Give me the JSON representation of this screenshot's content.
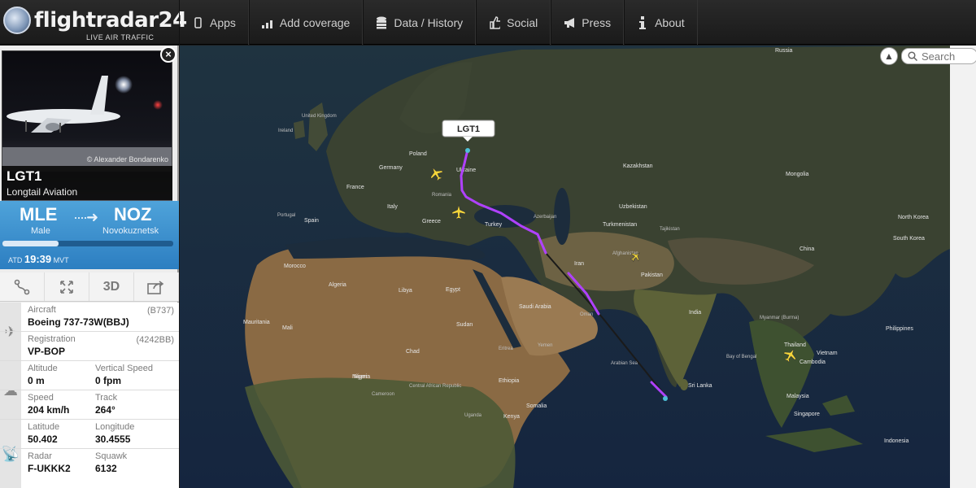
{
  "brand": {
    "name": "flightradar24",
    "tagline": "LIVE AIR TRAFFIC"
  },
  "nav": [
    {
      "label": "Apps",
      "icon": "phone-icon"
    },
    {
      "label": "Add coverage",
      "icon": "signal-bars-icon"
    },
    {
      "label": "Data / History",
      "icon": "database-icon"
    },
    {
      "label": "Social",
      "icon": "thumbs-up-icon"
    },
    {
      "label": "Press",
      "icon": "megaphone-icon"
    },
    {
      "label": "About",
      "icon": "info-icon"
    }
  ],
  "photo": {
    "credit": "© Alexander Bondarenko"
  },
  "flight": {
    "callsign": "LGT1",
    "airline": "Longtail Aviation",
    "origin": {
      "code": "MLE",
      "city": "Male"
    },
    "destination": {
      "code": "NOZ",
      "city": "Novokuznetsk"
    },
    "progress": 0.33,
    "atd_label": "ATD",
    "atd_time": "19:39",
    "atd_tz": "MVT"
  },
  "tools": [
    "route-icon",
    "fullscreen-icon",
    "3D",
    "share-icon"
  ],
  "details": {
    "aircraft_label": "Aircraft",
    "aircraft": "Boeing 737-73W(BBJ)",
    "aircraft_code": "(B737)",
    "registration_label": "Registration",
    "registration": "VP-BOP",
    "registration_code": "(4242BB)",
    "altitude_label": "Altitude",
    "altitude": "0 m",
    "vspeed_label": "Vertical Speed",
    "vspeed": "0 fpm",
    "speed_label": "Speed",
    "speed": "204 km/h",
    "track_label": "Track",
    "track": "264°",
    "latitude_label": "Latitude",
    "latitude": "50.402",
    "longitude_label": "Longitude",
    "longitude": "30.4555",
    "radar_label": "Radar",
    "radar": "F-UKKK2",
    "squawk_label": "Squawk",
    "squawk": "6132"
  },
  "map": {
    "callout": "LGT1",
    "labels": {
      "russia": "Russia",
      "kazakhstan": "Kazakhstan",
      "mongolia": "Mongolia",
      "china": "China",
      "india": "India",
      "egypt": "Egypt",
      "algeria": "Algeria",
      "libya": "Libya",
      "saudi_arabia": "Saudi Arabia",
      "turkey": "Turkey",
      "iran": "Iran",
      "pakistan": "Pakistan",
      "afghanistan": "Afghanistan",
      "sudan": "Sudan",
      "chad": "Chad",
      "niger": "Niger",
      "mali": "Mali",
      "nigeria": "Nigeria",
      "ethiopia": "Ethiopia",
      "kenya": "Kenya",
      "somalia": "Somalia",
      "spain": "Spain",
      "france": "France",
      "germany": "Germany",
      "poland": "Poland",
      "ukraine": "Ukraine",
      "greece": "Greece",
      "italy": "Italy",
      "morocco": "Morocco",
      "mauritania": "Mauritania",
      "uzbekistan": "Uzbekistan",
      "turkmenistan": "Turkmenistan",
      "thailand": "Thailand",
      "vietnam": "Vietnam",
      "cambodia": "Cambodia",
      "malaysia": "Malaysia",
      "indonesia": "Indonesia",
      "singapore": "Singapore",
      "philippines": "Philippines",
      "myanmar": "Myanmar (Burma)",
      "sri_lanka": "Sri Lanka",
      "south_korea": "South Korea",
      "north_korea": "North Korea",
      "united_kingdom": "United Kingdom",
      "ireland": "Ireland",
      "portugal": "Portugal",
      "romania": "Romania",
      "azerbaijan": "Azerbaijan",
      "tajikistan": "Tajikistan",
      "central_african_republic": "Central African Republic",
      "cameroon": "Cameroon",
      "yemen": "Yemen",
      "oman": "Oman",
      "eritrea": "Eritrea",
      "uganda": "Uganda",
      "arabian_sea": "Arabian Sea",
      "bay_of_bengal": "Bay of Bengal"
    }
  },
  "search": {
    "placeholder": "Search"
  },
  "colors": {
    "route": "#b041ff",
    "route_tail": "#1a1a1a",
    "aircraft": "#f4d63a",
    "header": "#3c92d2"
  }
}
